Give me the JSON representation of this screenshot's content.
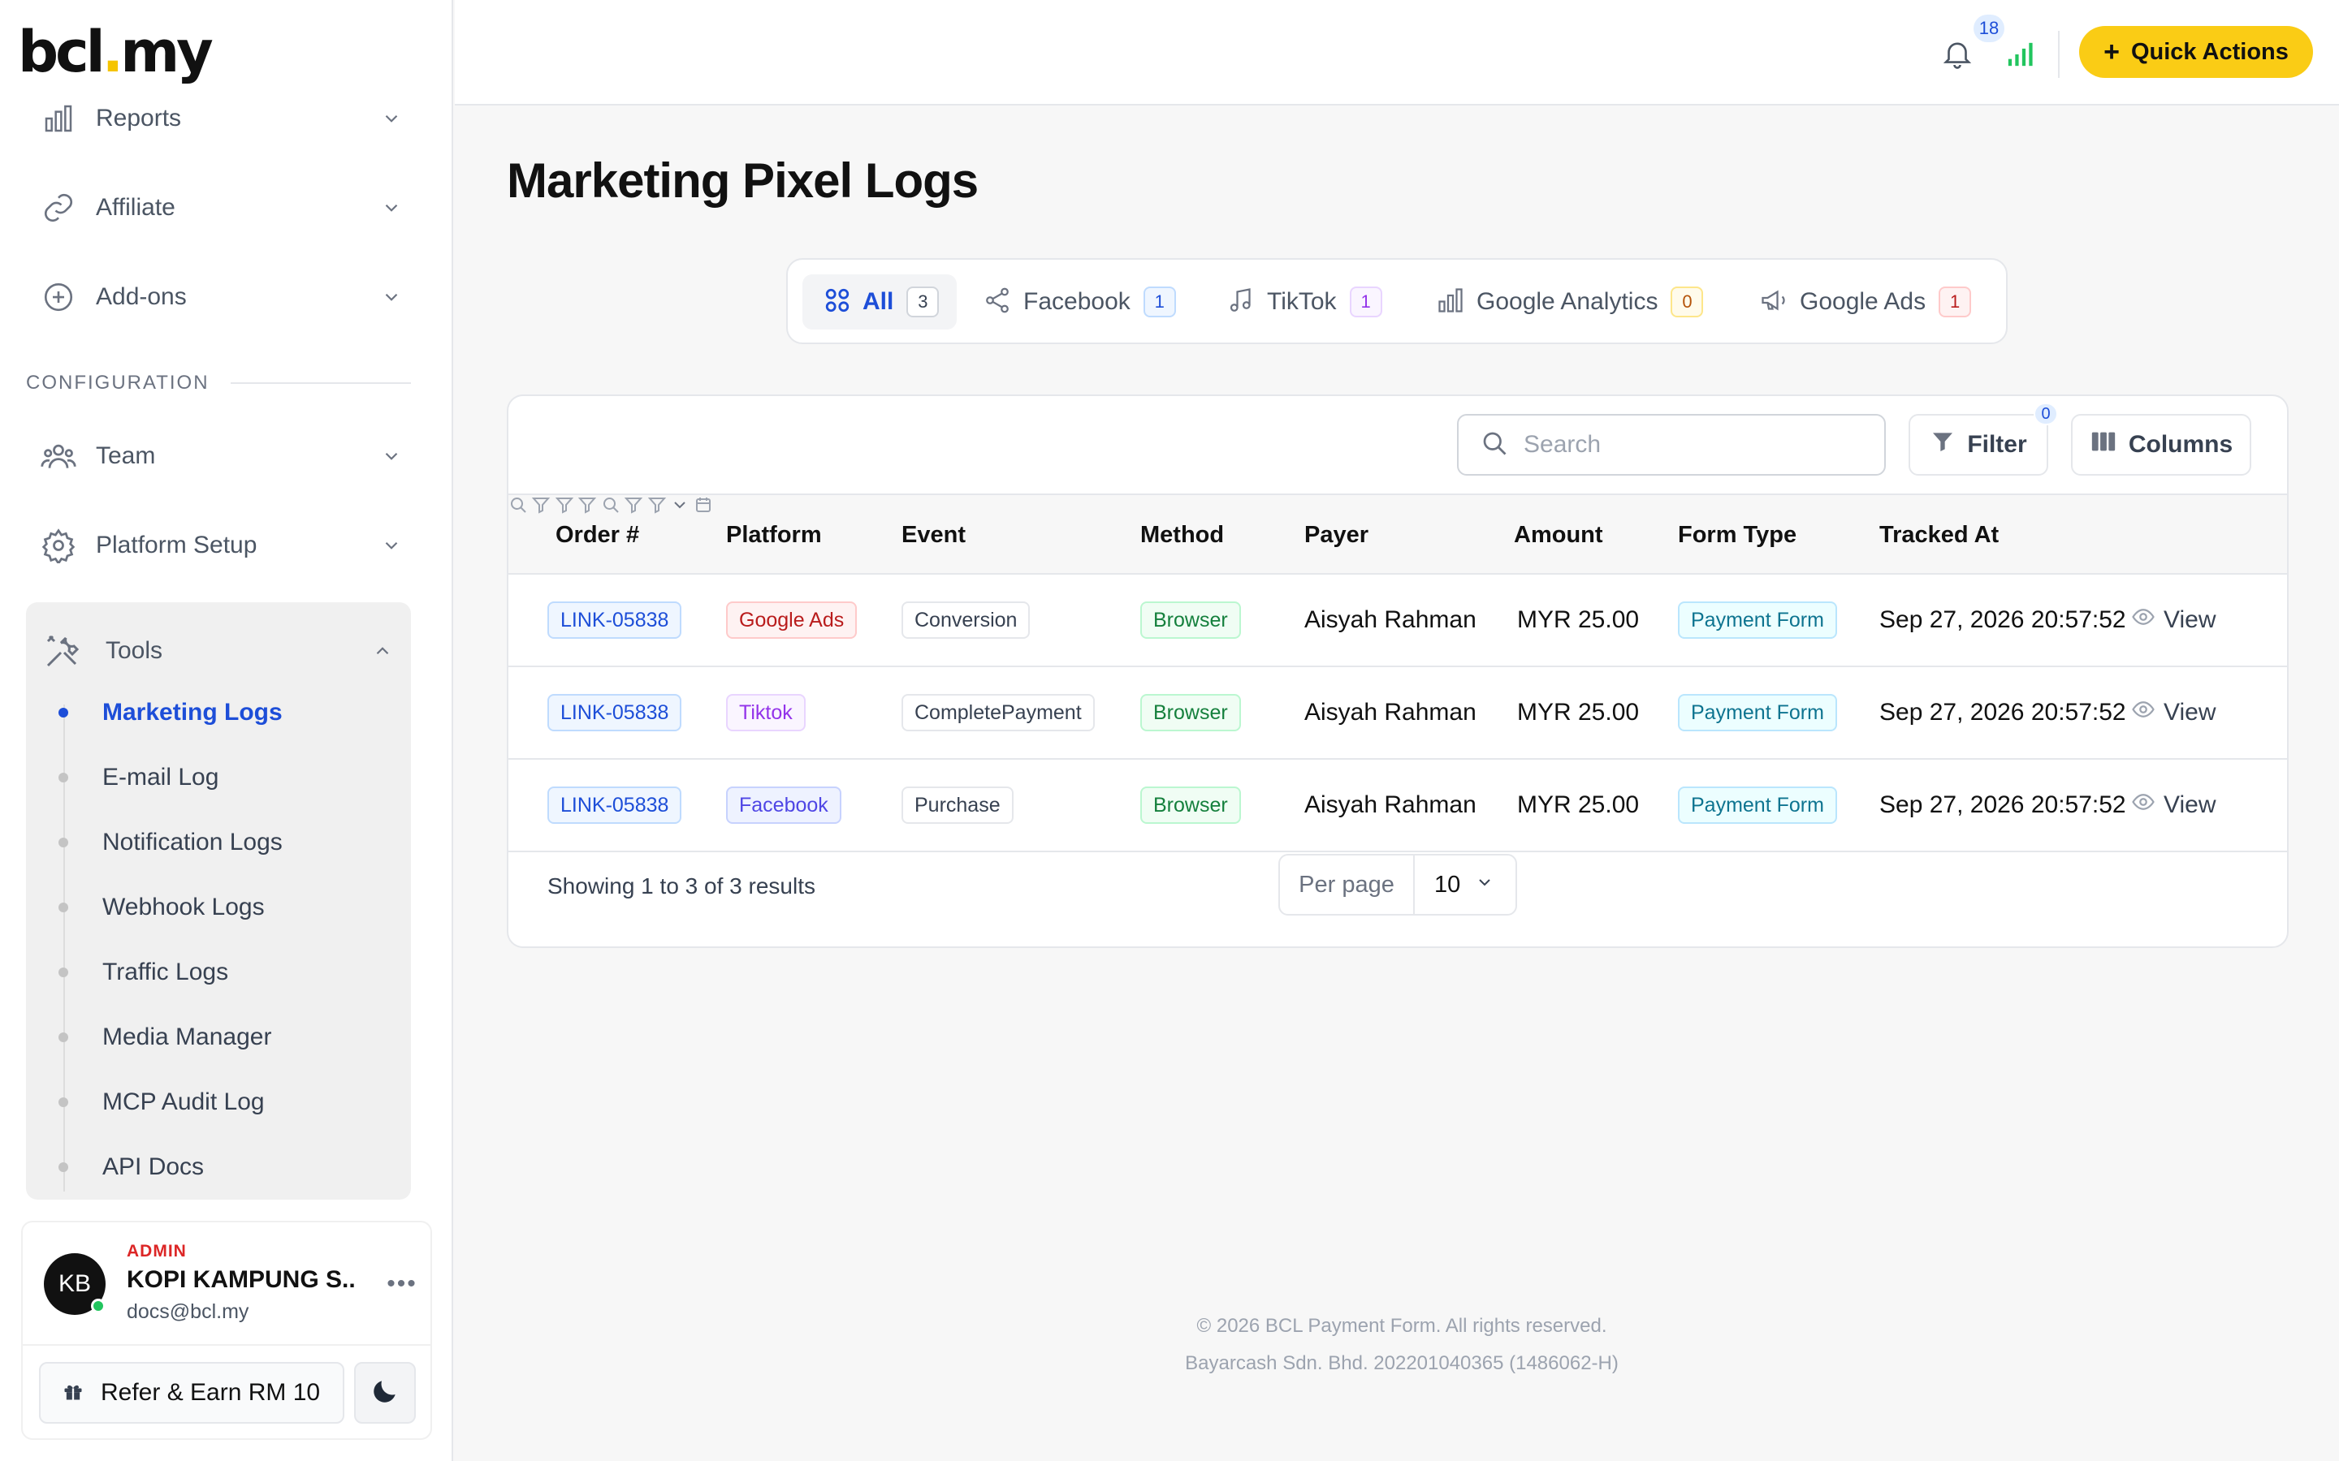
{
  "brand": {
    "logo_left": "bcl",
    "logo_dot": ".",
    "logo_right": "my"
  },
  "sidebar": {
    "items": [
      {
        "label": "Reports"
      },
      {
        "label": "Affiliate"
      },
      {
        "label": "Add-ons"
      }
    ],
    "section_label": "CONFIGURATION",
    "config_items": [
      {
        "label": "Team"
      },
      {
        "label": "Platform Setup"
      }
    ],
    "tools": {
      "label": "Tools",
      "items": [
        {
          "label": "Marketing Logs",
          "active": true
        },
        {
          "label": "E-mail Log"
        },
        {
          "label": "Notification Logs"
        },
        {
          "label": "Webhook Logs"
        },
        {
          "label": "Traffic Logs"
        },
        {
          "label": "Media Manager"
        },
        {
          "label": "MCP Audit Log"
        },
        {
          "label": "API Docs"
        }
      ]
    },
    "user": {
      "initials": "KB",
      "role": "ADMIN",
      "name": "KOPI KAMPUNG S...",
      "email": "docs@bcl.my",
      "more": "•••"
    },
    "refer_label": "Refer & Earn RM 10"
  },
  "header": {
    "notifications_count": "18",
    "quick_actions_label": "Quick Actions",
    "quick_actions_plus": "+"
  },
  "page": {
    "title": "Marketing Pixel Logs",
    "tabs": [
      {
        "label": "All",
        "count": "3",
        "active": true
      },
      {
        "label": "Facebook",
        "count": "1"
      },
      {
        "label": "TikTok",
        "count": "1"
      },
      {
        "label": "Google Analytics",
        "count": "0"
      },
      {
        "label": "Google Ads",
        "count": "1"
      }
    ],
    "search_placeholder": "Search",
    "filter_label": "Filter",
    "filter_count": "0",
    "columns_label": "Columns"
  },
  "table": {
    "columns": [
      "Order #",
      "Platform",
      "Event",
      "Method",
      "Payer",
      "Amount",
      "Form Type",
      "Tracked At"
    ],
    "rows": [
      {
        "order": "LINK-05838",
        "platform": "Google Ads",
        "event": "Conversion",
        "method": "Browser",
        "payer": "Aisyah Rahman",
        "amount": "MYR 25.00",
        "form_type": "Payment Form",
        "tracked_at": "Sep 27, 2026 20:57:52",
        "action": "View"
      },
      {
        "order": "LINK-05838",
        "platform": "Tiktok",
        "event": "CompletePayment",
        "method": "Browser",
        "payer": "Aisyah Rahman",
        "amount": "MYR 25.00",
        "form_type": "Payment Form",
        "tracked_at": "Sep 27, 2026 20:57:52",
        "action": "View"
      },
      {
        "order": "LINK-05838",
        "platform": "Facebook",
        "event": "Purchase",
        "method": "Browser",
        "payer": "Aisyah Rahman",
        "amount": "MYR 25.00",
        "form_type": "Payment Form",
        "tracked_at": "Sep 27, 2026 20:57:52",
        "action": "View"
      }
    ],
    "summary": "Showing 1 to 3 of 3 results",
    "per_page_label": "Per page",
    "per_page_value": "10"
  },
  "footer": {
    "copyright": "© 2026 BCL Payment Form. All rights reserved.",
    "company": "Bayarcash Sdn. Bhd. 202201040365 (1486062-H)"
  },
  "colors": {
    "accent": "#1d4ed8",
    "quick_actions": "#facc15",
    "signal": "#22c55e"
  }
}
